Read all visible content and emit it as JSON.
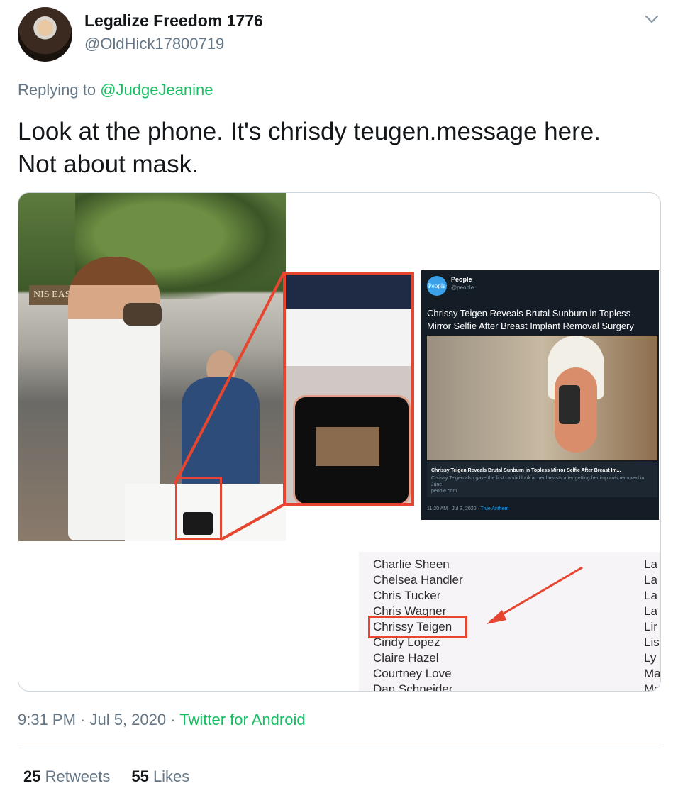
{
  "user": {
    "name": "Legalize Freedom 1776",
    "handle": "@OldHick17800719"
  },
  "reply": {
    "prefix": "Replying to ",
    "to": "@JudgeJeanine"
  },
  "tweet_text_line1": "Look at the phone. It's chrisdy teugen.message here.",
  "tweet_text_line2": "Not about mask.",
  "media": {
    "sign_text": "NIS EAST",
    "inner_tweet": {
      "logo_text": "People",
      "name": "People",
      "handle": "@people",
      "headline": "Chrissy Teigen Reveals Brutal Sunburn in Topless Mirror Selfie After Breast Implant Removal Surgery",
      "card_title": "Chrissy Teigen Reveals Brutal Sunburn in Topless Mirror Selfie After Breast Im...",
      "card_desc": "Chrissy Teigen also gave the first candid look at her breasts after getting her implants removed in June",
      "card_url": "people.com",
      "time": "11:20 AM · Jul 3, 2020 · ",
      "source": "True Anthem"
    },
    "list": {
      "names": [
        "Charlie Sheen",
        "Chelsea Handler",
        "Chris Tucker",
        "Chris Wagner",
        "Chrissy Teigen",
        "Cindy Lopez",
        "Claire Hazel",
        "Courtney Love",
        "Dan Schneider"
      ],
      "col2": [
        "La",
        "La",
        "La",
        "La",
        "Lir",
        "Lis",
        "Ly",
        "Ma",
        "Ma"
      ]
    }
  },
  "meta": {
    "time": "9:31 PM · Jul 5, 2020 · ",
    "source": "Twitter for Android"
  },
  "stats": {
    "retweets_count": "25",
    "retweets_label": "Retweets",
    "likes_count": "55",
    "likes_label": "Likes"
  },
  "colors": {
    "accent_green": "#17bf63",
    "highlight_red": "#e6452f",
    "muted": "#657786"
  }
}
